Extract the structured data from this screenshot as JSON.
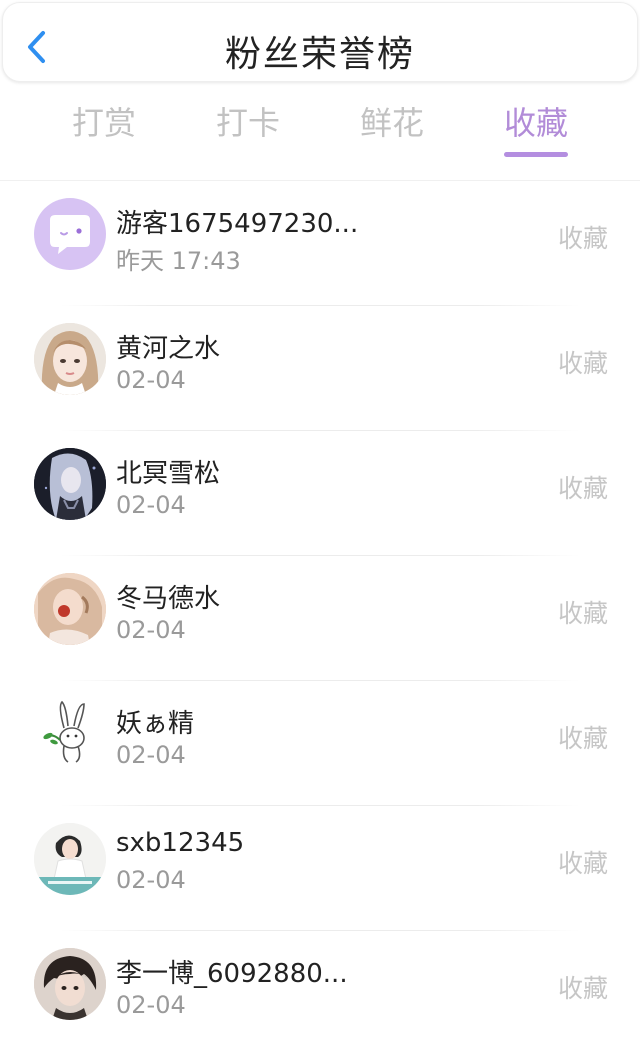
{
  "header": {
    "title": "粉丝荣誉榜",
    "back_icon": "chevron-left-icon",
    "accent_color": "#2f8ff0"
  },
  "tabs": [
    {
      "label": "打赏",
      "active": false
    },
    {
      "label": "打卡",
      "active": false
    },
    {
      "label": "鲜花",
      "active": false
    },
    {
      "label": "收藏",
      "active": true
    }
  ],
  "colors": {
    "active_tab": "#b28cd8",
    "inactive_tab": "#c2c2c2",
    "action_text": "#c6c6c6"
  },
  "fans": [
    {
      "name": "游客1675497230...",
      "time": "昨天 17:43",
      "action": "收藏",
      "avatar": "guest-chat-avatar"
    },
    {
      "name": "黄河之水",
      "time": "02-04",
      "action": "收藏",
      "avatar": "user-photo-avatar"
    },
    {
      "name": "北冥雪松",
      "time": "02-04",
      "action": "收藏",
      "avatar": "user-photo-avatar"
    },
    {
      "name": "冬马德水",
      "time": "02-04",
      "action": "收藏",
      "avatar": "user-photo-avatar"
    },
    {
      "name": "妖ぁ精",
      "time": "02-04",
      "action": "收藏",
      "avatar": "rabbit-sketch-avatar"
    },
    {
      "name": "sxb12345",
      "time": "02-04",
      "action": "收藏",
      "avatar": "user-photo-avatar"
    },
    {
      "name": "李一博_6092880...",
      "time": "02-04",
      "action": "收藏",
      "avatar": "user-photo-avatar"
    }
  ]
}
